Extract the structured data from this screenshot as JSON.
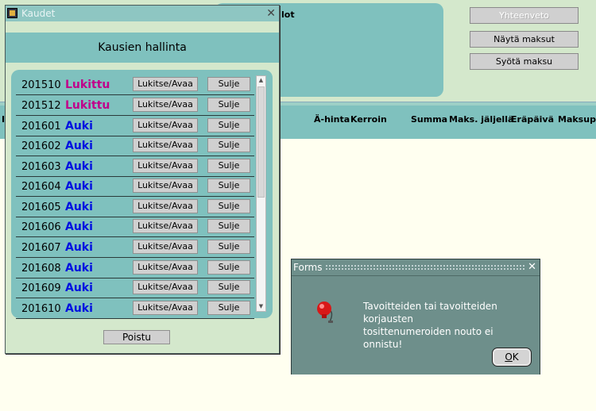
{
  "background": {
    "panel_text": "lot",
    "buttons": [
      "Yhteenveto",
      "Näytä maksut",
      "Syötä maksu"
    ],
    "columns": [
      "I",
      "Ä-hinta",
      "Kerroin",
      "Summa",
      "Maks. jäljellä",
      "Eräpäivä",
      "Maksupä"
    ]
  },
  "kaudet": {
    "title": "Kaudet",
    "header": "Kausien hallinta",
    "lock_label": "Lukitse/Avaa",
    "close_label": "Sulje",
    "rows": [
      {
        "code": "201510",
        "status": "Lukittu",
        "locked": true
      },
      {
        "code": "201512",
        "status": "Lukittu",
        "locked": true
      },
      {
        "code": "201601",
        "status": "Auki",
        "locked": false
      },
      {
        "code": "201602",
        "status": "Auki",
        "locked": false
      },
      {
        "code": "201603",
        "status": "Auki",
        "locked": false
      },
      {
        "code": "201604",
        "status": "Auki",
        "locked": false
      },
      {
        "code": "201605",
        "status": "Auki",
        "locked": false
      },
      {
        "code": "201606",
        "status": "Auki",
        "locked": false
      },
      {
        "code": "201607",
        "status": "Auki",
        "locked": false
      },
      {
        "code": "201608",
        "status": "Auki",
        "locked": false
      },
      {
        "code": "201609",
        "status": "Auki",
        "locked": false
      },
      {
        "code": "201610",
        "status": "Auki",
        "locked": false
      }
    ],
    "exit_label": "Poistu"
  },
  "forms": {
    "title": "Forms",
    "message_line1": "Tavoitteiden tai tavoitteiden korjausten",
    "message_line2": "tosittenumeroiden nouto ei onnistu!",
    "ok_label": "OK",
    "icon": "alarm-bell-icon"
  },
  "colors": {
    "locked": "#c0008a",
    "open": "#0010e0",
    "teal": "#7fc1be"
  }
}
